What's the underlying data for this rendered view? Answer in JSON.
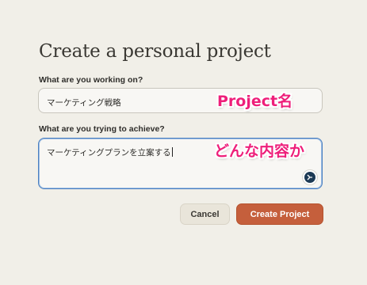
{
  "dialog": {
    "title": "Create a personal project",
    "name_label": "What are you working on?",
    "name_value": "マーケティング戦略",
    "goal_label": "What are you trying to achieve?",
    "goal_value": "マーケティングプランを立案する",
    "cancel_label": "Cancel",
    "create_label": "Create Project"
  },
  "annotations": {
    "name_note": "Project名",
    "goal_note": "どんな内容か"
  },
  "colors": {
    "background": "#f1efe8",
    "primary_button": "#c55f3c",
    "annotation": "#ee1f7a",
    "focus_border": "#4a7fc0"
  },
  "icons": {
    "assistant": "grammar-assistant-icon"
  }
}
